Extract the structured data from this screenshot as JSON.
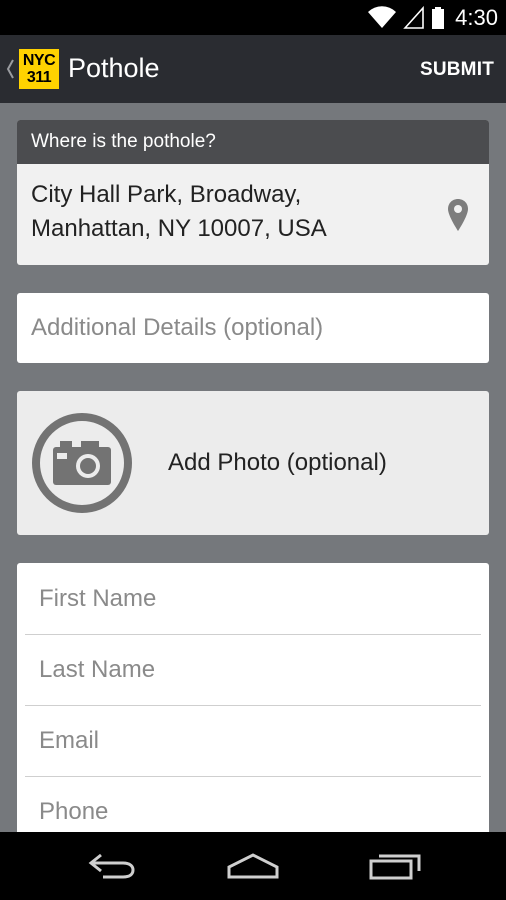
{
  "status_bar": {
    "time": "4:30",
    "icons": [
      "wifi-icon",
      "cell-signal-icon",
      "battery-icon"
    ]
  },
  "action_bar": {
    "logo": {
      "line1": "NYC",
      "line2": "311"
    },
    "title": "Pothole",
    "submit_label": "SUBMIT",
    "up_icon": "chevron-left-icon"
  },
  "location": {
    "header": "Where is the pothole?",
    "address_line1": "City Hall Park, Broadway,",
    "address_line2": "Manhattan, NY 10007, USA",
    "icon": "map-pin-icon"
  },
  "details": {
    "placeholder": "Additional Details (optional)",
    "value": ""
  },
  "photo": {
    "label": "Add Photo (optional)",
    "icon": "camera-icon"
  },
  "contact": {
    "first_name_placeholder": "First Name",
    "last_name_placeholder": "Last Name",
    "email_placeholder": "Email",
    "phone_placeholder": "Phone"
  },
  "nav_bar": {
    "icons": [
      "back-icon",
      "home-icon",
      "recent-apps-icon"
    ]
  },
  "colors": {
    "background": "#75787c",
    "action_bar": "#2a2c31",
    "logo_yellow": "#ffd200",
    "header_dark": "#4b4c4f"
  }
}
